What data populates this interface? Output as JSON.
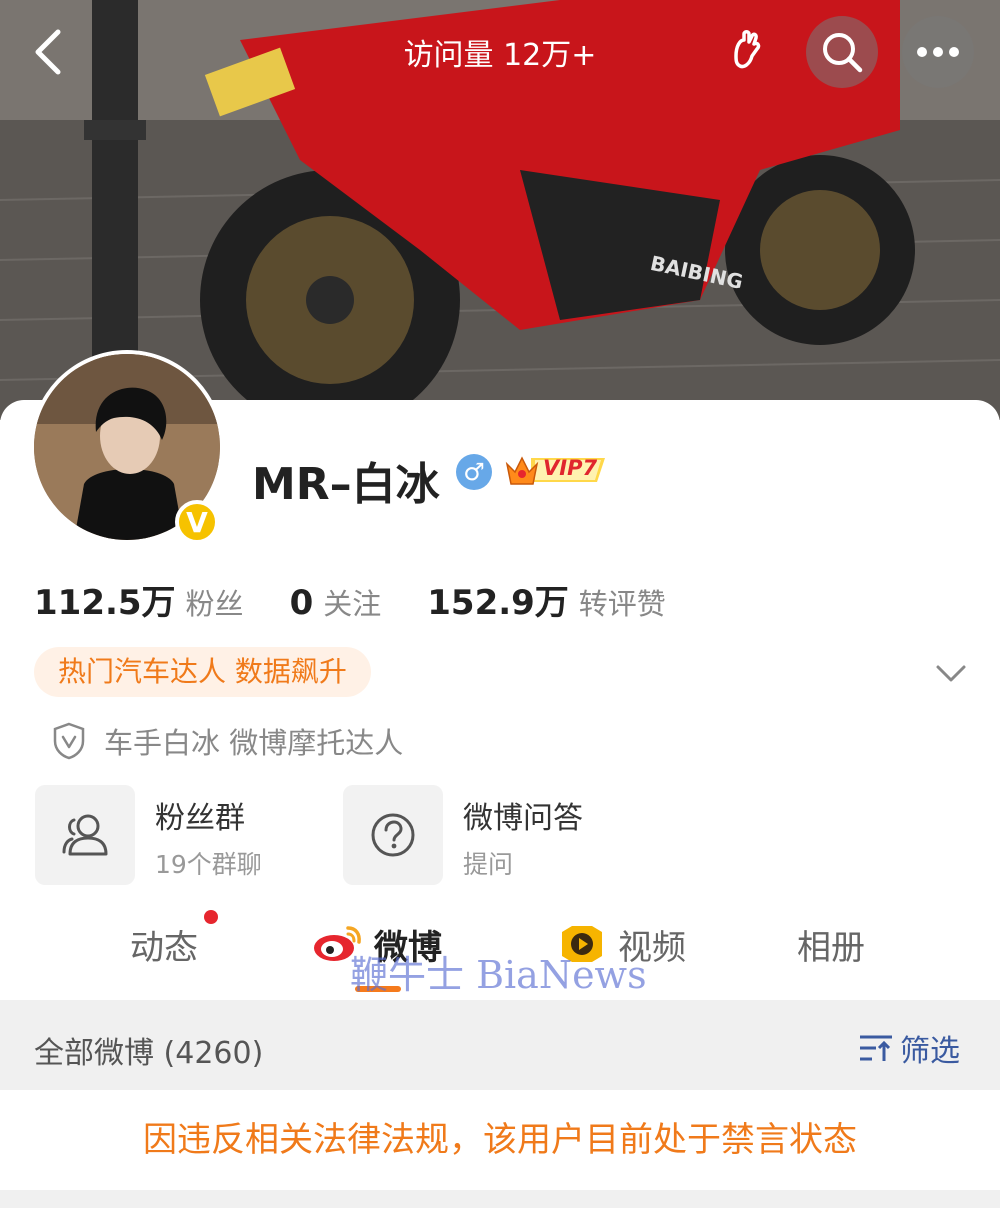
{
  "header": {
    "title": "访问量 12万+"
  },
  "cover": {
    "brand_text": "BAIBING"
  },
  "profile": {
    "name": "MR–白冰",
    "gender_symbol": "♂",
    "vip_label": "VIP7",
    "verified_badge": "V"
  },
  "stats": [
    {
      "value": "112.5万",
      "label": "粉丝"
    },
    {
      "value": "0",
      "label": "关注"
    },
    {
      "value": "152.9万",
      "label": "转评赞"
    }
  ],
  "tag": "热门汽车达人 数据飙升",
  "certification": "车手白冰 微博摩托达人",
  "tiles": [
    {
      "title": "粉丝群",
      "subtitle": "19个群聊",
      "icon": "group-icon"
    },
    {
      "title": "微博问答",
      "subtitle": "提问",
      "icon": "question-icon"
    }
  ],
  "tabs": [
    {
      "label": "动态"
    },
    {
      "label": "微博"
    },
    {
      "label": "视频"
    },
    {
      "label": "相册"
    }
  ],
  "watermark": "鞭牛士 BiaNews",
  "feed": {
    "all_label": "全部微博 (4260)",
    "filter_label": "筛选"
  },
  "notice": "因违反相关法律法规，该用户目前处于禁言状态",
  "colors": {
    "accent_orange": "#f07a1a",
    "tag_bg": "#fff1e6",
    "vip_gold": "#f6c200",
    "gender_blue": "#67a8e8",
    "filter_blue": "#3a5aa0"
  }
}
